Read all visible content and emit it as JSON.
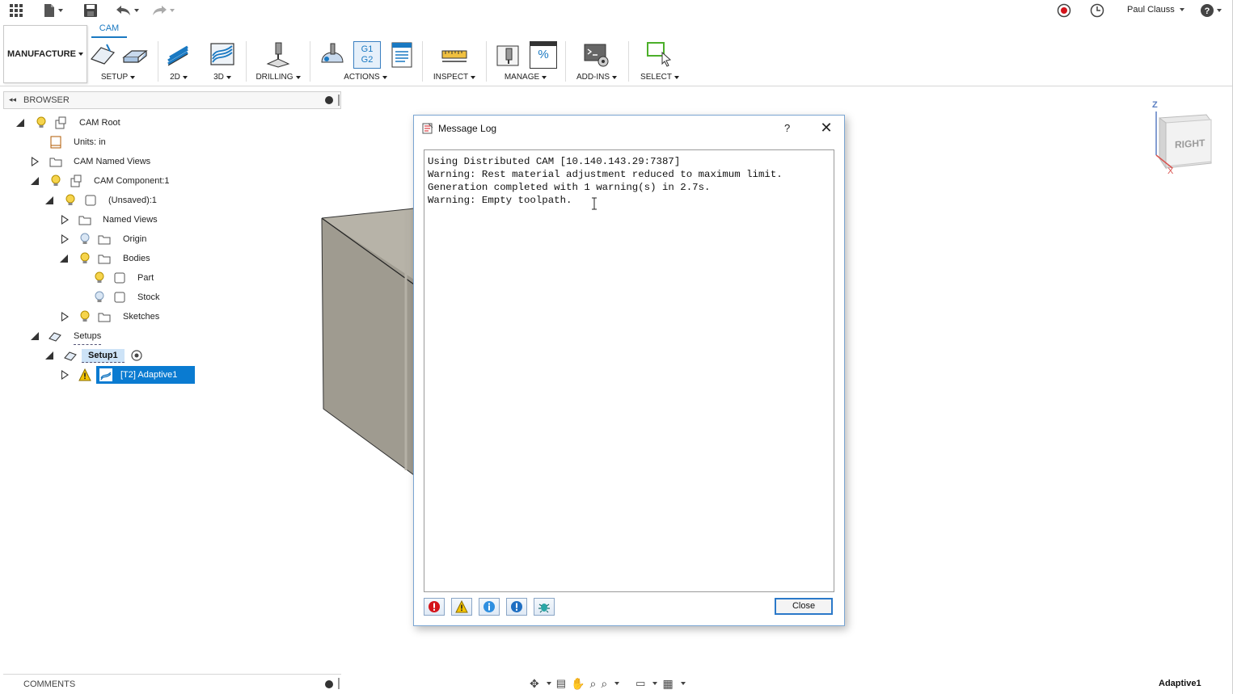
{
  "app": {
    "user_name": "Paul Clauss",
    "colors": {
      "accent": "#1a79c2",
      "selection": "#0a7bd1",
      "warning": "#f4c400",
      "error": "#d4141b"
    }
  },
  "quick_access": {
    "icons": [
      "apps-grid-icon",
      "file-icon",
      "save-icon",
      "undo-icon",
      "redo-icon",
      "record-icon",
      "history-icon",
      "help-icon"
    ]
  },
  "ribbon": {
    "workspace_label": "MANUFACTURE",
    "active_tab": "CAM",
    "groups": [
      {
        "label": "SETUP"
      },
      {
        "label": "2D"
      },
      {
        "label": "3D"
      },
      {
        "label": "DRILLING"
      },
      {
        "label": "ACTIONS"
      },
      {
        "label": "INSPECT"
      },
      {
        "label": "MANAGE"
      },
      {
        "label": "ADD-INS"
      },
      {
        "label": "SELECT"
      }
    ],
    "actions_gcode_text": [
      "G1",
      "G2"
    ],
    "manage_percent": "%"
  },
  "browser": {
    "title": "BROWSER",
    "tree": [
      {
        "label": "CAM Root"
      },
      {
        "label": "Units: in"
      },
      {
        "label": "CAM Named Views"
      },
      {
        "label": "CAM Component:1"
      },
      {
        "label": "(Unsaved):1"
      },
      {
        "label": "Named Views"
      },
      {
        "label": "Origin"
      },
      {
        "label": "Bodies"
      },
      {
        "label": "Part"
      },
      {
        "label": "Stock"
      },
      {
        "label": "Sketches"
      },
      {
        "label": "Setups"
      },
      {
        "label": "Setup1"
      },
      {
        "label": "[T2] Adaptive1"
      }
    ]
  },
  "viewcube": {
    "face_label": "RIGHT",
    "axis_z": "Z",
    "axis_x": "X"
  },
  "dialog": {
    "title": "Message Log",
    "help_label": "?",
    "close_glyph": "✕",
    "log_lines": [
      "Using Distributed CAM [10.140.143.29:7387]",
      "Warning: Rest material adjustment reduced to maximum limit.",
      "Generation completed with 1 warning(s) in 2.7s.",
      "Warning: Empty toolpath."
    ],
    "filters": [
      "error-filter-icon",
      "warning-filter-icon",
      "info-filter-icon",
      "important-filter-icon",
      "debug-filter-icon"
    ],
    "close_label": "Close"
  },
  "comments": {
    "title": "COMMENTS"
  },
  "status": {
    "active_item": "Adaptive1"
  }
}
